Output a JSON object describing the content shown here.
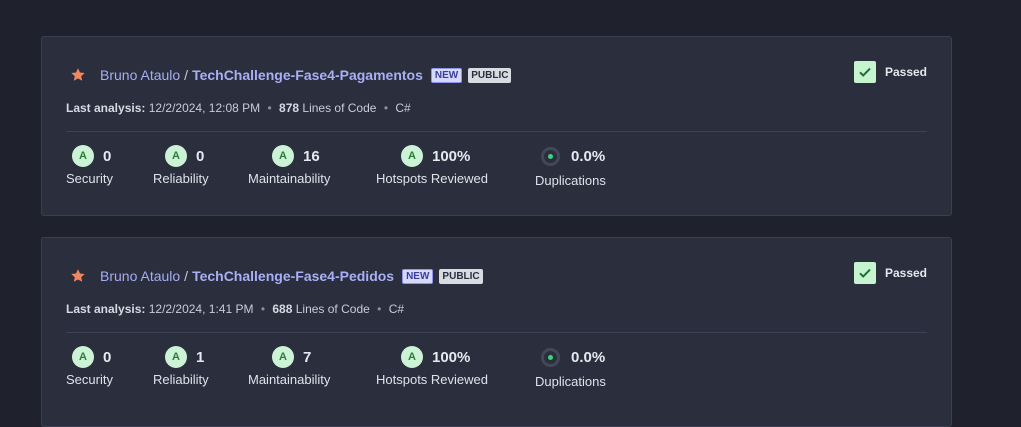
{
  "projects": [
    {
      "owner": "Bruno Ataulo",
      "separator": "/",
      "repo": "TechChallenge-Fase4-Pagamentos",
      "new_badge": "NEW",
      "visibility_badge": "PUBLIC",
      "status": "Passed",
      "analysis_label": "Last analysis:",
      "analysis_date": "12/2/2024, 12:08 PM",
      "lines_count": "878",
      "lines_label": "Lines of Code",
      "language": "C#",
      "metrics": {
        "security": {
          "grade": "A",
          "value": "0",
          "label": "Security"
        },
        "reliability": {
          "grade": "A",
          "value": "0",
          "label": "Reliability"
        },
        "maintainability": {
          "grade": "A",
          "value": "16",
          "label": "Maintainability"
        },
        "hotspots": {
          "grade": "A",
          "value": "100%",
          "label": "Hotspots Reviewed"
        },
        "duplications": {
          "value": "0.0%",
          "label": "Duplications"
        }
      }
    },
    {
      "owner": "Bruno Ataulo",
      "separator": "/",
      "repo": "TechChallenge-Fase4-Pedidos",
      "new_badge": "NEW",
      "visibility_badge": "PUBLIC",
      "status": "Passed",
      "analysis_label": "Last analysis:",
      "analysis_date": "12/2/2024, 1:41 PM",
      "lines_count": "688",
      "lines_label": "Lines of Code",
      "language": "C#",
      "metrics": {
        "security": {
          "grade": "A",
          "value": "0",
          "label": "Security"
        },
        "reliability": {
          "grade": "A",
          "value": "1",
          "label": "Reliability"
        },
        "maintainability": {
          "grade": "A",
          "value": "7",
          "label": "Maintainability"
        },
        "hotspots": {
          "grade": "A",
          "value": "100%",
          "label": "Hotspots Reviewed"
        },
        "duplications": {
          "value": "0.0%",
          "label": "Duplications"
        }
      }
    }
  ],
  "colors": {
    "background": "#1f212d",
    "card": "#2a2e3d",
    "link": "#a9aff4",
    "star": "#f0875f",
    "passed": "#c6f4cf",
    "grade_a": "#cdf3d6"
  },
  "icons": {
    "favorite": "star-icon",
    "status": "check-icon",
    "duplications": "donut-icon"
  }
}
